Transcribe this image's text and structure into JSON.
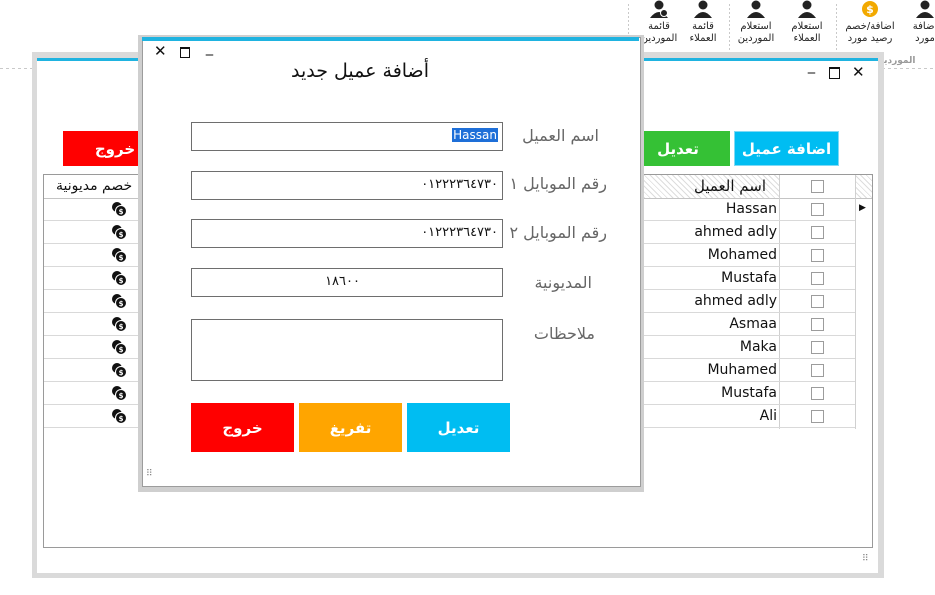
{
  "ribbon": {
    "buttons": [
      {
        "line1": "قائمة",
        "line2": "الموردين",
        "icon": "supplier-list-icon"
      },
      {
        "line1": "قائمة",
        "line2": "العملاء",
        "icon": "customer-list-icon"
      },
      {
        "line1": "استعلام",
        "line2": "الموردين",
        "icon": "supplier-query-icon"
      },
      {
        "line1": "استعلام",
        "line2": "العملاء",
        "icon": "customer-query-icon"
      },
      {
        "line1": "اضافة/خصم",
        "line2": "رصيد مورد",
        "icon": "supplier-balance-icon"
      },
      {
        "line1": "اضافة",
        "line2": "مورد",
        "icon": "add-supplier-icon"
      }
    ],
    "group_label": "الموردين"
  },
  "background_form": {
    "buttons": {
      "exit": "خروج",
      "edit": "تعديل",
      "add_customer": "اضافة عميل"
    },
    "columns": {
      "name": "اسم العميل",
      "debt_discount": "خصم مديونية"
    },
    "rows": [
      "Hassan",
      "ahmed adly",
      "Mohamed",
      "Mustafa",
      "ahmed adly",
      "Asmaa",
      "Maka",
      "Muhamed",
      "Mustafa",
      "Ali"
    ]
  },
  "dialog": {
    "title": "أضافة عميل جديد",
    "fields": {
      "name": {
        "label": "اسم العميل",
        "value": "Hassan"
      },
      "mobile1": {
        "label": "رقم الموبايل ١",
        "value": "٠١٢٢٢٣٦٤٧٣٠"
      },
      "mobile2": {
        "label": "رقم الموبايل ٢",
        "value": "٠١٢٢٢٣٦٤٧٣٠"
      },
      "debt": {
        "label": "المديونية",
        "value": "١٨٦٠٠"
      },
      "notes": {
        "label": "ملاحظات",
        "value": ""
      }
    },
    "buttons": {
      "exit": "خروج",
      "clear": "تفريغ",
      "edit": "تعديل"
    }
  },
  "colors": {
    "accent": "#1fb3e0",
    "red": "#ff0000",
    "green": "#35c135",
    "blue": "#00bdf2",
    "orange": "#ffa500"
  }
}
